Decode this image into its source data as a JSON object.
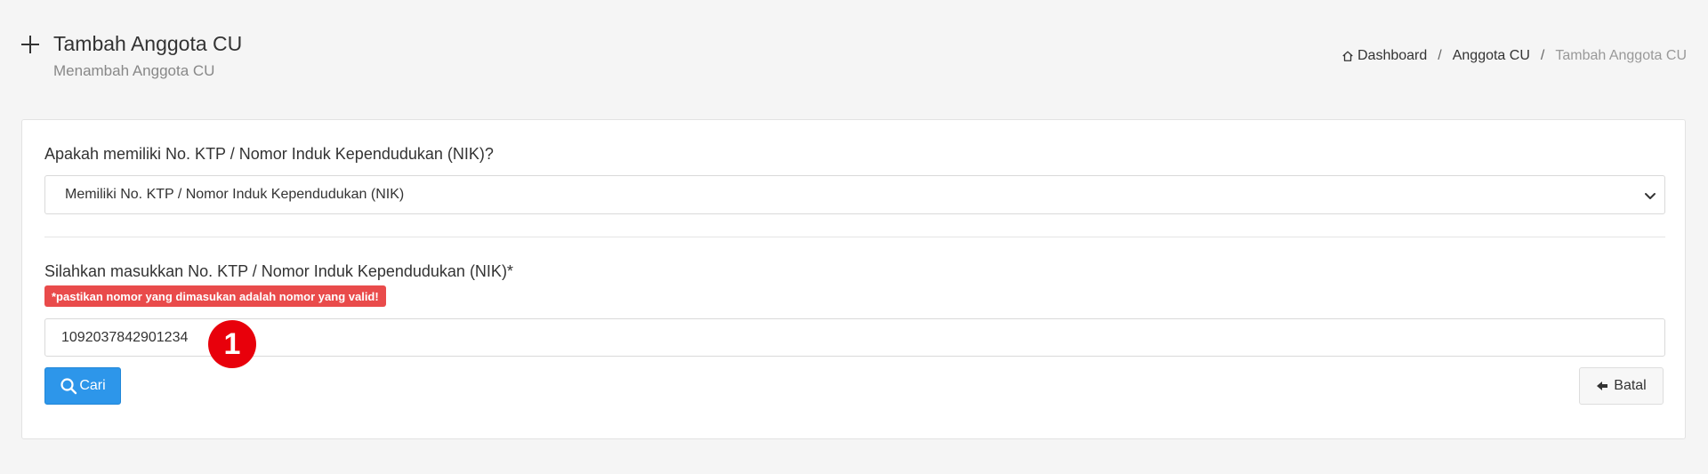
{
  "header": {
    "title": "Tambah Anggota CU",
    "subtitle": "Menambah Anggota CU"
  },
  "breadcrumb": {
    "items": [
      "Dashboard",
      "Anggota CU",
      "Tambah Anggota CU"
    ],
    "separator": "/"
  },
  "form": {
    "question_label": "Apakah memiliki No. KTP / Nomor Induk Kependudukan (NIK)?",
    "question_selected": "Memiliki No. KTP / Nomor Induk Kependudukan (NIK)",
    "nik_label": "Silahkan masukkan No. KTP / Nomor Induk Kependudukan (NIK)*",
    "nik_warning": "*pastikan nomor yang dimasukan adalah nomor yang valid!",
    "nik_value": "1092037842901234"
  },
  "actions": {
    "search_label": "Cari",
    "cancel_label": "Batal"
  },
  "annotation": {
    "step_number": "1"
  },
  "colors": {
    "primary": "#2d96ea",
    "danger": "#e94b4b",
    "marker": "#e8000b"
  }
}
